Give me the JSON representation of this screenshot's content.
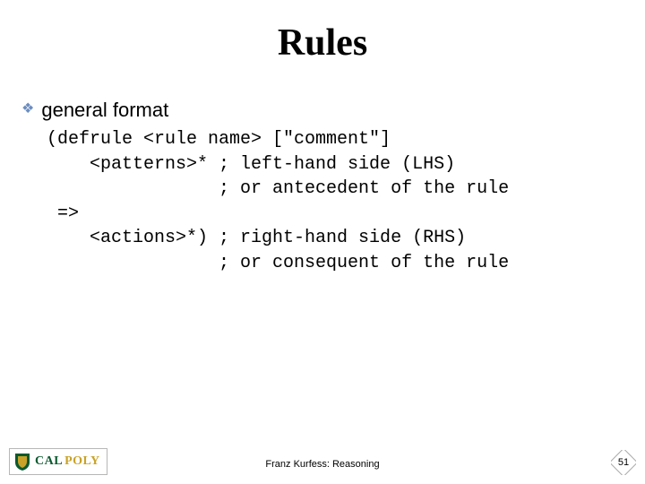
{
  "title": "Rules",
  "bullet": {
    "icon_glyph": "❖",
    "text": "general format"
  },
  "code": {
    "line1": "(defrule <rule name> [\"comment\"]",
    "line2": "    <patterns>* ; left-hand side (LHS)",
    "line3": "                ; or antecedent of the rule",
    "line4": " =>",
    "line5": "    <actions>*) ; right-hand side (RHS)",
    "line6": "                ; or consequent of the rule"
  },
  "footer": "Franz Kurfess: Reasoning",
  "page_number": "51",
  "logo": {
    "cal": "CAL",
    "poly": "POLY"
  }
}
